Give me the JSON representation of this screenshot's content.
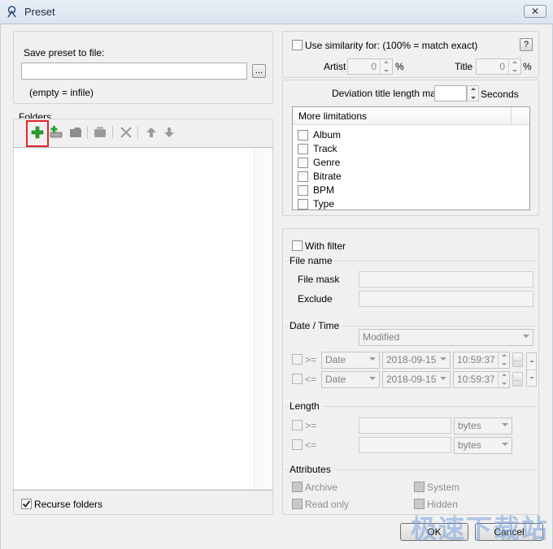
{
  "window": {
    "title": "Preset",
    "close_glyph": "✕"
  },
  "save": {
    "label": "Save preset to file:",
    "value": "",
    "browse_label": "...",
    "hint": "(empty = infile)"
  },
  "folders": {
    "label": "Folders",
    "toolbar": [
      "add-folder-icon",
      "add-drive-icon",
      "folder-icon",
      "disk-icon",
      "delete-icon",
      "arrow-up-icon",
      "arrow-down-icon"
    ],
    "recurse_label": "Recurse folders",
    "recurse_checked": true
  },
  "similarity": {
    "label": "Use similarity for: (100% = match exact)",
    "help": "?",
    "artist_label": "Artist",
    "artist_value": "0",
    "title_label": "Title",
    "title_value": "0",
    "percent": "%"
  },
  "deviation": {
    "label": "Deviation title length max.",
    "value": "",
    "unit": "Seconds"
  },
  "limitations": {
    "header": "More limitations",
    "items": [
      "Album",
      "Track",
      "Genre",
      "Bitrate",
      "BPM",
      "Type"
    ]
  },
  "filter": {
    "with_filter_label": "With filter",
    "file_name_group": "File name",
    "file_mask_label": "File mask",
    "file_mask_value": "",
    "exclude_label": "Exclude",
    "exclude_value": "",
    "date_time_group": "Date / Time",
    "date_mode": "Modified",
    "rows": [
      {
        "op": ">=",
        "type": "Date",
        "date": "2018-09-15",
        "time": "10:59:37"
      },
      {
        "op": "<=",
        "type": "Date",
        "date": "2018-09-15",
        "time": "10:59:37"
      }
    ],
    "length_group": "Length",
    "length_rows": [
      {
        "op": ">=",
        "value": "",
        "unit": "bytes"
      },
      {
        "op": "<=",
        "value": "",
        "unit": "bytes"
      }
    ],
    "attributes_group": "Attributes",
    "attributes": [
      "Archive",
      "System",
      "Read only",
      "Hidden"
    ]
  },
  "buttons": {
    "ok": "OK",
    "cancel": "Cancel"
  },
  "watermark": "极速下载站",
  "colors": {
    "highlight": "#e0262b",
    "add_green": "#2aa52a"
  }
}
